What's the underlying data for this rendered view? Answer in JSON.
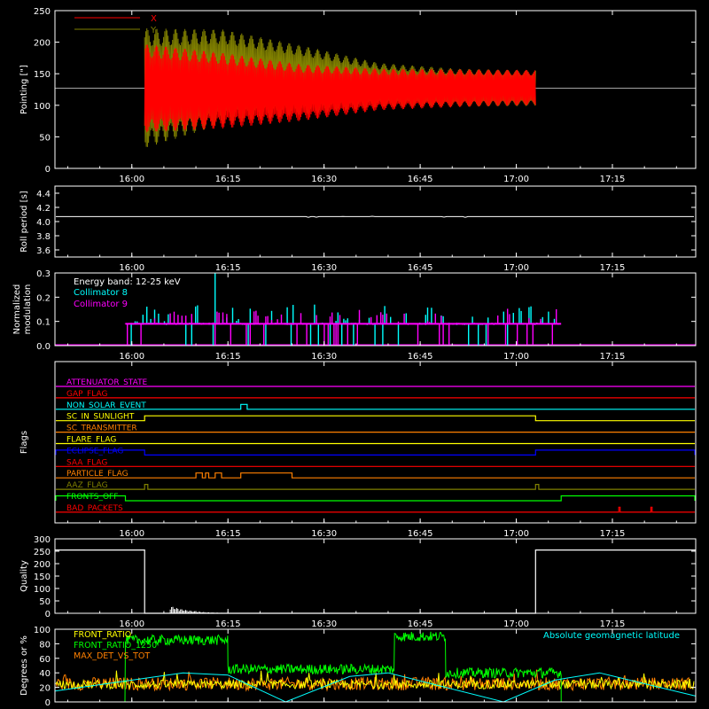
{
  "chart_data": [
    {
      "type": "line",
      "ylabel": "Pointing [\"]",
      "ylim": [
        0,
        250
      ],
      "yticks": [
        0,
        50,
        100,
        150,
        200,
        250
      ],
      "x_time_range": [
        "15:48",
        "17:28"
      ],
      "xticks": [
        "16:00",
        "16:15",
        "16:30",
        "16:45",
        "17:00",
        "17:15"
      ],
      "legend_position": "top-left",
      "reference_line": 127,
      "series": [
        {
          "name": "X",
          "color": "#ff0000",
          "start": "16:02",
          "end": "17:03",
          "center": [
            127,
            123,
            120,
            125,
            127,
            128
          ],
          "amplitude": [
            70,
            60,
            45,
            33,
            30,
            28
          ]
        },
        {
          "name": "Y",
          "color": "#808000",
          "start": "16:02",
          "end": "17:03",
          "center": [
            127,
            145,
            140,
            132,
            128,
            127
          ],
          "amplitude": [
            95,
            75,
            55,
            35,
            30,
            28
          ]
        }
      ]
    },
    {
      "type": "line",
      "ylabel": "Roll period [s]",
      "ylim": [
        3.5,
        4.5
      ],
      "yticks": [
        "3.6",
        "3.8",
        "4.0",
        "4.2",
        "4.4"
      ],
      "xticks": [
        "16:00",
        "16:15",
        "16:30",
        "16:45",
        "17:00",
        "17:15"
      ],
      "series": [
        {
          "name": "",
          "color": "#ffffff",
          "value": 4.07
        }
      ]
    },
    {
      "type": "bar",
      "ylabel": "Normalized modulation",
      "ylim": [
        0,
        0.3
      ],
      "yticks": [
        "0.0",
        "0.1",
        "0.2",
        "0.3"
      ],
      "xticks": [
        "16:00",
        "16:15",
        "16:30",
        "16:45",
        "17:00",
        "17:15"
      ],
      "annotation": "Energy band: 12-25 keV",
      "active_range": [
        "15:59",
        "17:07"
      ],
      "baseline": 0.09,
      "series": [
        {
          "name": "Collimator 8",
          "color": "#00ffff"
        },
        {
          "name": "Collimator 9",
          "color": "#ff00ff"
        }
      ]
    },
    {
      "type": "line",
      "ylabel": "Flags",
      "xticks": [
        "16:00",
        "16:15",
        "16:30",
        "16:45",
        "17:00",
        "17:15"
      ],
      "flags": [
        {
          "name": "ATTENUATOR_STATE",
          "color": "#ff00ff",
          "on": []
        },
        {
          "name": "GAP_FLAG",
          "color": "#ff0000",
          "on": []
        },
        {
          "name": "NON_SOLAR_EVENT",
          "color": "#00ffff",
          "on": [
            [
              "16:17",
              "16:18"
            ]
          ]
        },
        {
          "name": "SC_IN_SUNLIGHT",
          "color": "#ffff00",
          "on": [
            [
              "16:02",
              "17:03"
            ]
          ]
        },
        {
          "name": "SC_TRANSMITTER",
          "color": "#ff8000",
          "on": []
        },
        {
          "name": "FLARE_FLAG",
          "color": "#ffff00",
          "on": []
        },
        {
          "name": "ECLIPSE_FLAG",
          "color": "#0000ff",
          "on": [
            [
              "15:48",
              "16:02"
            ],
            [
              "17:03",
              "17:28"
            ]
          ]
        },
        {
          "name": "SAA_FLAG",
          "color": "#ff0000",
          "on": []
        },
        {
          "name": "PARTICLE_FLAG",
          "color": "#ff8000",
          "on": [
            [
              "16:10",
              "16:11"
            ],
            [
              "16:11.5",
              "16:12"
            ],
            [
              "16:13",
              "16:14"
            ],
            [
              "16:17",
              "16:25"
            ]
          ]
        },
        {
          "name": "AAZ_FLAG",
          "color": "#808000",
          "on": [
            [
              "16:02",
              "16:02.5"
            ],
            [
              "17:03",
              "17:03.5"
            ]
          ]
        },
        {
          "name": "FRONTS_OFF",
          "color": "#00ff00",
          "on": [
            [
              "15:48",
              "15:59"
            ],
            [
              "17:07",
              "17:28"
            ]
          ]
        },
        {
          "name": "BAD_PACKETS",
          "color": "#ff0000",
          "on": [
            [
              "17:16",
              "17:16.2"
            ],
            [
              "17:21",
              "17:21.2"
            ]
          ]
        }
      ]
    },
    {
      "type": "line",
      "ylabel": "Quality",
      "ylim": [
        0,
        300
      ],
      "yticks": [
        0,
        50,
        100,
        150,
        200,
        250,
        300
      ],
      "xticks": [
        "16:00",
        "16:15",
        "16:30",
        "16:45",
        "17:00",
        "17:15"
      ],
      "series": [
        {
          "name": "",
          "color": "#ffffff",
          "points": [
            [
              "15:48",
              255
            ],
            [
              "16:02",
              255
            ],
            [
              "16:02",
              0
            ],
            [
              "17:03",
              0
            ],
            [
              "17:03",
              255
            ],
            [
              "17:28",
              255
            ]
          ]
        }
      ]
    },
    {
      "type": "line",
      "ylabel": "Degrees or %",
      "ylim": [
        0,
        100
      ],
      "yticks": [
        0,
        20,
        40,
        60,
        80,
        100
      ],
      "xticks": [
        "16:00",
        "16:15",
        "16:30",
        "16:45",
        "17:00",
        "17:15"
      ],
      "annotation": "Absolute geomagnetic latitude",
      "series": [
        {
          "name": "FRONT_RATIO",
          "color": "#ffff00",
          "mean": 24,
          "noise": 6
        },
        {
          "name": "FRONT_RATIO_1250",
          "color": "#00ff00",
          "segments": [
            [
              "15:48",
              "15:59",
              0
            ],
            [
              "15:59",
              "16:15",
              85
            ],
            [
              "16:15",
              "16:41",
              45
            ],
            [
              "16:41",
              "16:49",
              90
            ],
            [
              "16:49",
              "17:07",
              40
            ],
            [
              "17:07",
              "17:28",
              0
            ]
          ]
        },
        {
          "name": "MAX_DET_VS_TOT",
          "color": "#ff8000",
          "mean": 25,
          "noise": 9
        },
        {
          "name": "Absolute geomagnetic latitude",
          "color": "#00ffff",
          "points": [
            [
              "15:48",
              15
            ],
            [
              "16:08",
              40
            ],
            [
              "16:15",
              37
            ],
            [
              "16:24",
              0
            ],
            [
              "16:34",
              35
            ],
            [
              "16:40",
              40
            ],
            [
              "16:58",
              0
            ],
            [
              "17:06",
              30
            ],
            [
              "17:13",
              40
            ],
            [
              "17:28",
              8
            ]
          ]
        }
      ]
    }
  ]
}
